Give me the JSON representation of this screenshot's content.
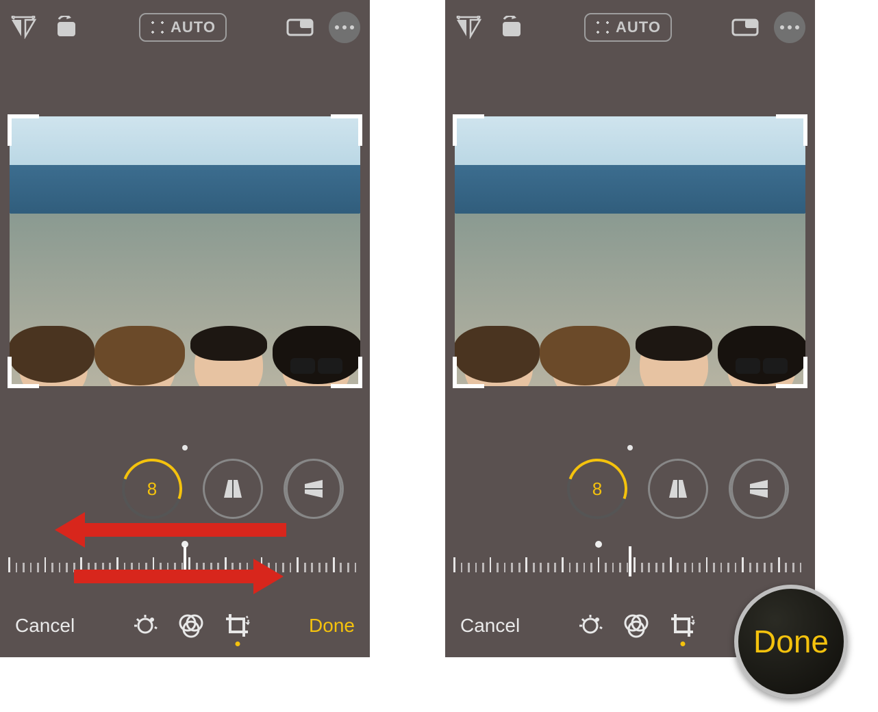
{
  "topbar": {
    "auto_label": "AUTO"
  },
  "dials": {
    "straighten_value": "8"
  },
  "ruler": {
    "left_dot_offset_pct": 50,
    "right_dot_offset_pct": 41
  },
  "bottom": {
    "cancel_label": "Cancel",
    "done_label": "Done"
  },
  "highlight": {
    "done_label": "Done"
  }
}
